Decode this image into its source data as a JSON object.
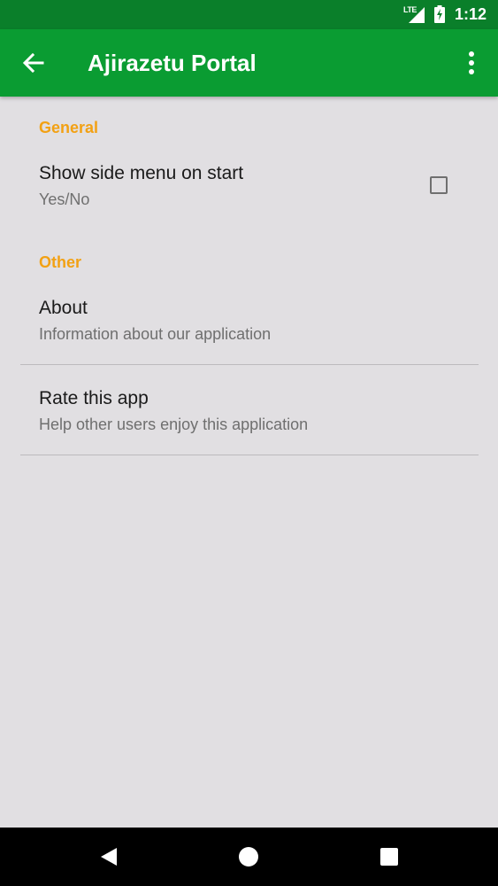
{
  "status_bar": {
    "network": "LTE",
    "time": "1:12",
    "icons": [
      "signal-icon",
      "battery-charging-icon"
    ]
  },
  "app_bar": {
    "title": "Ajirazetu Portal",
    "back_icon": "arrow-left-icon",
    "overflow_icon": "more-vertical-icon",
    "color": "#0a9c32"
  },
  "categories": {
    "general": "General",
    "other": "Other"
  },
  "preferences": {
    "side_menu": {
      "title": "Show side menu on start",
      "summary": "Yes/No",
      "checked": false
    },
    "about": {
      "title": "About",
      "summary": "Information about our application"
    },
    "rate": {
      "title": "Rate this app",
      "summary": "Help other users enjoy this application"
    }
  },
  "theme": {
    "accent": "#f2a114",
    "status_bar": "#0a7f2a",
    "background": "#e1dfe2"
  },
  "nav_bar": {
    "icons": [
      "nav-back-icon",
      "nav-home-icon",
      "nav-recents-icon"
    ]
  }
}
